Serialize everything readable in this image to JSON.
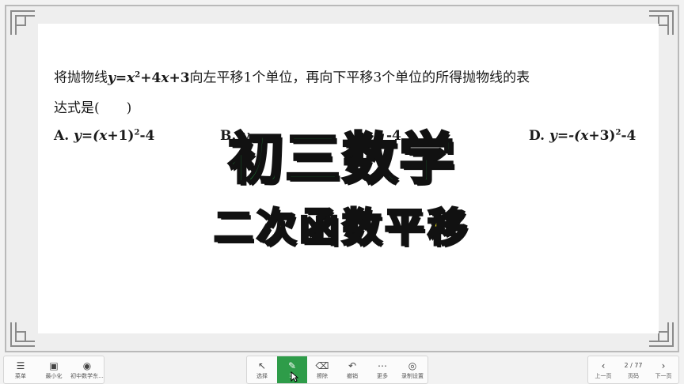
{
  "question": {
    "line1_prefix": "将抛物线",
    "y": "y",
    "eq": "=",
    "x": "x",
    "exp2": "2",
    "plus4": "+4",
    "x2": "x",
    "plus3": "+3",
    "line1_suffix": "向左平移1个单位，再向下平移3个单位的所得抛物线的表",
    "line2": "达式是(　　)"
  },
  "options": {
    "a": {
      "label": "A. ",
      "expr_start": "y=(",
      "x": "x",
      "expr_mid": "+1)",
      "exp": "2",
      "expr_end": "-4"
    },
    "b": {
      "label": "B. ",
      "visible": "y"
    },
    "c": {
      "visible_end": "-4"
    },
    "d": {
      "label": "D. ",
      "expr_start": "y=-(",
      "x": "x",
      "expr_mid": "+3)",
      "exp": "2",
      "expr_end": "-4"
    }
  },
  "overlay": {
    "title": "初三数学",
    "subtitle": "二次函数平移"
  },
  "toolbar": {
    "left": [
      {
        "icon": "menu-icon",
        "label": "菜单"
      },
      {
        "icon": "minimize-icon",
        "label": "最小化"
      },
      {
        "icon": "avatar-icon",
        "label": "初中数学东..."
      }
    ],
    "center": [
      {
        "icon": "cursor-icon",
        "label": "选择"
      },
      {
        "icon": "pen-icon",
        "label": "笔"
      },
      {
        "icon": "eraser-icon",
        "label": "擦除"
      },
      {
        "icon": "undo-icon",
        "label": "撤销"
      },
      {
        "icon": "more-icon",
        "label": "更多"
      },
      {
        "icon": "record-icon",
        "label": "录制设置"
      }
    ],
    "right": {
      "prev_label": "上一页",
      "page": "2 / 77",
      "page_sub": "页码",
      "next_label": "下一页"
    },
    "accent": "#2e9c49"
  }
}
